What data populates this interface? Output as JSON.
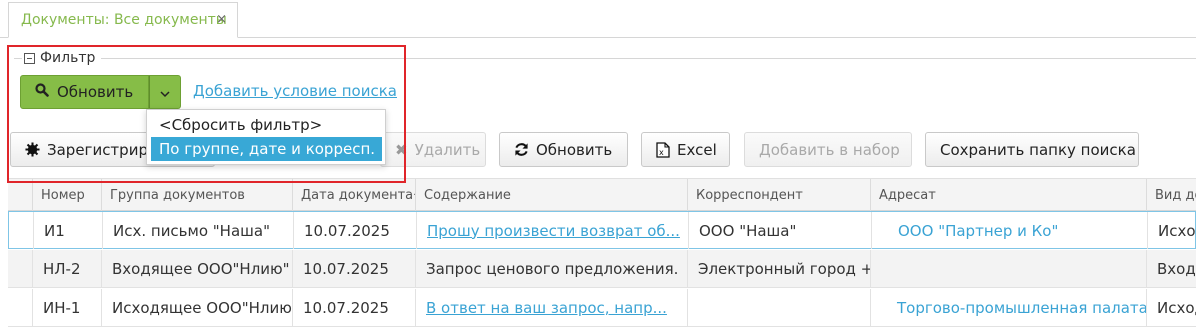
{
  "tab": {
    "label": "Документы: Все документы",
    "close": "×"
  },
  "filter": {
    "legend": "Фильтр",
    "refresh_label": "Обновить",
    "add_condition": "Добавить условие поиска",
    "menu": [
      "<Сбросить фильтр>",
      "По группе, дате и корресп."
    ]
  },
  "toolbar": {
    "register": "Зарегистрировать",
    "delete": "Удалить",
    "refresh": "Обновить",
    "excel": "Excel",
    "add_to_set": "Добавить в набор",
    "save_folder": "Сохранить папку поиска"
  },
  "table": {
    "columns": [
      "Номер",
      "Группа документов",
      "Дата документа",
      "Содержание",
      "Корреспондент",
      "Адресат",
      "Вид до"
    ],
    "sorted_column": "Дата документа",
    "rows": [
      {
        "number": "И1",
        "group": "Исх. письмо \"Наша\"",
        "date": "10.07.2025",
        "content": "Прошу произвести возврат об...",
        "correspondent": "ООО \"Наша\"",
        "addressee": "ООО \"Партнер и Ко\"",
        "kind": "Исходя"
      },
      {
        "number": "НЛ-2",
        "group": "Входящее ООО\"Нлию\"",
        "date": "10.07.2025",
        "content": "Запрос ценового предложения.",
        "correspondent": "Электронный город +",
        "addressee": "",
        "kind": "Входя"
      },
      {
        "number": "ИН-1",
        "group": "Исходящее ООО\"Нлию\"",
        "date": "10.07.2025",
        "content": "В ответ на ваш запрос, напр...",
        "correspondent": "",
        "addressee": "Торгово-промышленная палата",
        "kind": "Исходя"
      }
    ]
  },
  "colors": {
    "accent_green": "#86bd47",
    "link_blue": "#3aa3d4",
    "highlight_blue": "#38a8d6",
    "annotation_red": "#e0252a"
  }
}
